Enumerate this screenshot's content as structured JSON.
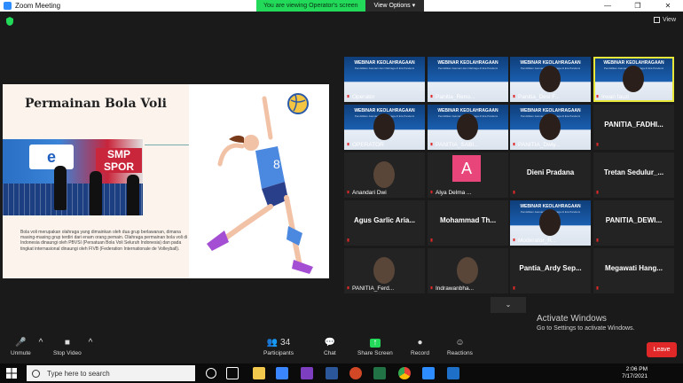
{
  "window": {
    "title": "Zoom Meeting",
    "controls": [
      "—",
      "❐",
      "✕"
    ]
  },
  "banner": {
    "notice": "You are viewing Operator's screen",
    "view_options": "View Options ▾"
  },
  "view_button": "View",
  "slide": {
    "title": "Permainan Bola Voli",
    "photo_sign": "e",
    "photo_sign2": "SMP SPOR",
    "paragraph": "Bola voli merupakan olahraga yang dimainkan oleh dua grup berlawanan, dimana masing-masing grup terdiri dari enam orang pemain. Olahraga permainan bola voli di Indonesia dinaungi oleh PBVSI (Persatuan Bola Voli Seluruh Indonesia) dan pada tingkat internasional dinaungi oleh FIVB (Federation Internationale de Volleyball)."
  },
  "webinar": {
    "title": "WEBINAR KEOLAHRAGAAN",
    "sub": "Pendidikan Jasmani dan Olahraga di Era Pandemi"
  },
  "participants": [
    {
      "name": "Operator",
      "kind": "webinar"
    },
    {
      "name": "Panitia_Reno...",
      "kind": "webinar"
    },
    {
      "name": "Panitia_Desi F...",
      "kind": "webinar-face"
    },
    {
      "name": "Irwan fauzi",
      "kind": "webinar-face",
      "active": true
    },
    {
      "name": "OPERATOR",
      "kind": "webinar-face"
    },
    {
      "name": "PANITIA_SABI...",
      "kind": "webinar-face"
    },
    {
      "name": "PANITIA_Dwiy...",
      "kind": "webinar-face"
    },
    {
      "name": "PANITIA_FADHI...",
      "kind": "text"
    },
    {
      "name": "Anandari Dwi",
      "kind": "face"
    },
    {
      "name": "Alya Delma ...",
      "kind": "avatar",
      "initial": "A"
    },
    {
      "name": "Dieni Pradana",
      "kind": "text"
    },
    {
      "name": "Tretan Sedulur_...",
      "kind": "text"
    },
    {
      "name": "Agus Garlic Aria...",
      "kind": "text"
    },
    {
      "name": "Mohammad Th...",
      "kind": "text"
    },
    {
      "name": "Moderator_R...",
      "kind": "webinar-face"
    },
    {
      "name": "PANITIA_DEWI...",
      "kind": "text"
    },
    {
      "name": "PANITIA_Ferd...",
      "kind": "face"
    },
    {
      "name": "Indrawanbha...",
      "kind": "face"
    },
    {
      "name": "Pantia_Ardy Sep...",
      "kind": "text"
    },
    {
      "name": "Megawati Hang...",
      "kind": "text"
    }
  ],
  "activate": {
    "line1": "Activate Windows",
    "line2": "Go to Settings to activate Windows."
  },
  "toolbar": {
    "unmute": "Unmute",
    "stop_video": "Stop Video",
    "participants": "Participants",
    "participants_count": "34",
    "chat": "Chat",
    "share": "Share Screen",
    "record": "Record",
    "reactions": "Reactions",
    "leave": "Leave"
  },
  "taskbar": {
    "search_placeholder": "Type here to search",
    "time": "2:06 PM",
    "date": "7/17/2021"
  },
  "colors": {
    "zoom_blue": "#2d8cff",
    "share_green": "#23d959",
    "leave_red": "#e02828",
    "active_speaker": "#e8e83a"
  }
}
